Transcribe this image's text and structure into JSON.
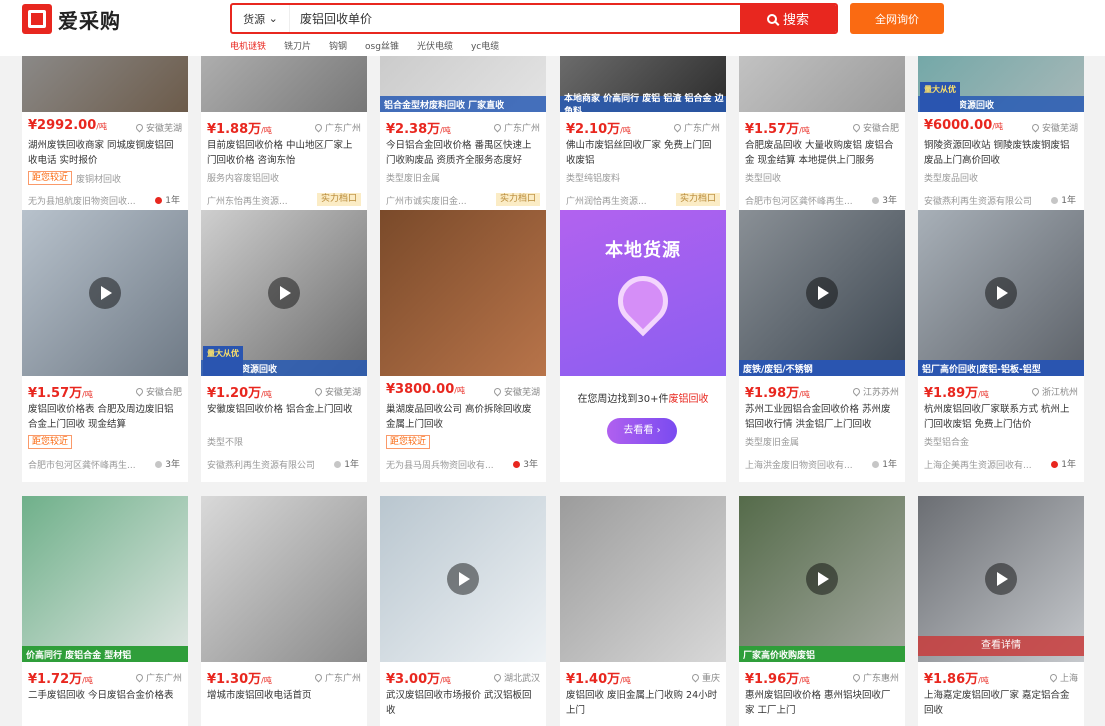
{
  "brand": {
    "name": "爱采购"
  },
  "search": {
    "category": "货源",
    "query": "废铝回收单价",
    "button": "搜索",
    "inquiry": "全网询价"
  },
  "hot_words": [
    "电机谜铁",
    "铣刀片",
    "钩钢",
    "osg丝锥",
    "光伏电缆",
    "yc电缆"
  ],
  "local": {
    "title": "本地货源",
    "text_prefix": "在您周边找到30+件",
    "text_highlight": "废铝回收",
    "button": "去看看 ›"
  },
  "cards": [
    {
      "price": "¥2992.00",
      "unit": "/吨",
      "loc": "安徽芜湖",
      "title": "湖州废铁回收商家 同城废铜废铝回收电话 实时报价",
      "near": "距您较近",
      "tag": "废铜材回收",
      "company": "无为县旭航废旧物资回收...",
      "years": "1年",
      "yearsRed": true,
      "strength": false,
      "overlay": "",
      "badge": ""
    },
    {
      "price": "¥1.88万",
      "unit": "/吨",
      "loc": "广东广州",
      "title": "目前废铝回收价格 中山地区厂家上门回收价格 咨询东怡",
      "near": "",
      "tag": "服务内容废铝回收",
      "company": "广州东怡再生资源...",
      "years": "",
      "yearsRed": false,
      "strength": true,
      "strengthText": "实力档口",
      "overlay": "",
      "badge": ""
    },
    {
      "price": "¥2.38万",
      "unit": "/吨",
      "loc": "广东广州",
      "title": "今日铝合金回收价格 番禺区快速上门收购废品 资质齐全服务态度好",
      "near": "",
      "tag": "类型废旧金属",
      "company": "广州市诚实废旧金...",
      "years": "",
      "yearsRed": false,
      "strength": true,
      "strengthText": "实力档口",
      "overlay": "铝合金型材废料回收 厂家直收",
      "badge": ""
    },
    {
      "price": "¥2.10万",
      "unit": "/吨",
      "loc": "广东广州",
      "title": "佛山市废铝丝回收厂家 免费上门回收废铝",
      "near": "",
      "tag": "类型纯铝废料",
      "company": "广州润恰再生资源...",
      "years": "",
      "yearsRed": false,
      "strength": true,
      "strengthText": "实力档口",
      "overlay": "本地商家 价高同行 废铝 铝渣 铝合金 边角料",
      "badge": ""
    },
    {
      "price": "¥1.57万",
      "unit": "/吨",
      "loc": "安徽合肥",
      "title": "合肥废品回收 大量收购废铝 废铝合金 现金结算 本地提供上门服务",
      "near": "",
      "tag": "类型回收",
      "company": "合肥市包河区龚怀峰再生...",
      "years": "3年",
      "yearsRed": false,
      "strength": false,
      "overlay": "",
      "badge": ""
    },
    {
      "price": "¥6000.00",
      "unit": "/吨",
      "loc": "安徽芜湖",
      "title": "铜陵资源回收站 铜陵废铁废铜废铝废品上门高价回收",
      "near": "",
      "tag": "类型废品回收",
      "company": "安徽燕利再生资源有限公司",
      "years": "1年",
      "yearsRed": false,
      "strength": false,
      "overlay": "燕利专业资源回收",
      "badge": "量大从优"
    },
    {
      "price": "¥1.57万",
      "unit": "/吨",
      "loc": "安徽合肥",
      "title": "废铝回收价格表 合肥及周边废旧铝合金上门回收 现金结算",
      "near": "距您较近",
      "tag": "",
      "company": "合肥市包河区龚怀峰再生...",
      "years": "3年",
      "yearsRed": false,
      "strength": false,
      "overlay": "",
      "badge": ""
    },
    {
      "price": "¥1.20万",
      "unit": "/吨",
      "loc": "安徽芜湖",
      "title": "安徽废铝回收价格 铝合金上门回收",
      "near": "",
      "tag": "类型不限",
      "company": "安徽燕利再生资源有限公司",
      "years": "1年",
      "yearsRed": false,
      "strength": false,
      "overlay": "燕利专业资源回收",
      "badge": "量大从优"
    },
    {
      "price": "¥3800.00",
      "unit": "/吨",
      "loc": "安徽芜湖",
      "title": "巢湖废品回收公司 高价拆除回收废金属上门回收",
      "near": "距您较近",
      "tag": "",
      "company": "无为县马周兵物资回收有...",
      "years": "3年",
      "yearsRed": true,
      "strength": false,
      "overlay": "",
      "badge": ""
    },
    {
      "price": "¥1.98万",
      "unit": "/吨",
      "loc": "江苏苏州",
      "title": "苏州工业园铝合金回收价格 苏州废铝回收行情 洪金铝厂上门回收",
      "near": "",
      "tag": "类型废旧金属",
      "company": "上海洪金废旧物资回收有...",
      "years": "1年",
      "yearsRed": false,
      "strength": false,
      "overlay": "废铁/废铝/不锈钢",
      "badge": ""
    },
    {
      "price": "¥1.89万",
      "unit": "/吨",
      "loc": "浙江杭州",
      "title": "杭州废铝回收厂家联系方式 杭州上门回收废铝 免费上门估价",
      "near": "",
      "tag": "类型铝合金",
      "company": "上海企美再生资源回收有...",
      "years": "1年",
      "yearsRed": true,
      "strength": false,
      "overlay": "铝厂高价回收|废铝-铝板-铝型",
      "badge": ""
    },
    {
      "price": "¥1.72万",
      "unit": "/吨",
      "loc": "广东广州",
      "title": "二手废铝回收 今日废铝合金价格表",
      "overlay": "价高同行 废铝合金 型材铝",
      "badge": ""
    },
    {
      "price": "¥1.30万",
      "unit": "/吨",
      "loc": "广东广州",
      "title": "增城市废铝回收电话首页",
      "overlay": "",
      "badge": ""
    },
    {
      "price": "¥3.00万",
      "unit": "/吨",
      "loc": "湖北武汉",
      "title": "武汉废铝回收市场报价 武汉铝板回收",
      "overlay": "",
      "badge": ""
    },
    {
      "price": "¥1.40万",
      "unit": "/吨",
      "loc": "重庆",
      "title": "废铝回收 废旧金属上门收购 24小时上门",
      "overlay": "",
      "badge": ""
    },
    {
      "price": "¥1.96万",
      "unit": "/吨",
      "loc": "广东惠州",
      "title": "惠州废铝回收价格 惠州铝块回收厂家 工厂上门",
      "overlay": "厂家高价收购废铝",
      "badge": ""
    },
    {
      "price": "¥1.86万",
      "unit": "/吨",
      "loc": "上海",
      "title": "上海嘉定废铝回收厂家 嘉定铝合金回收",
      "overlay": "",
      "badge": "",
      "detail": "查看详情"
    }
  ],
  "colors": {
    "brand": "#e8271f",
    "orange": "#fa6a12",
    "purple": "#8a5ef0"
  }
}
